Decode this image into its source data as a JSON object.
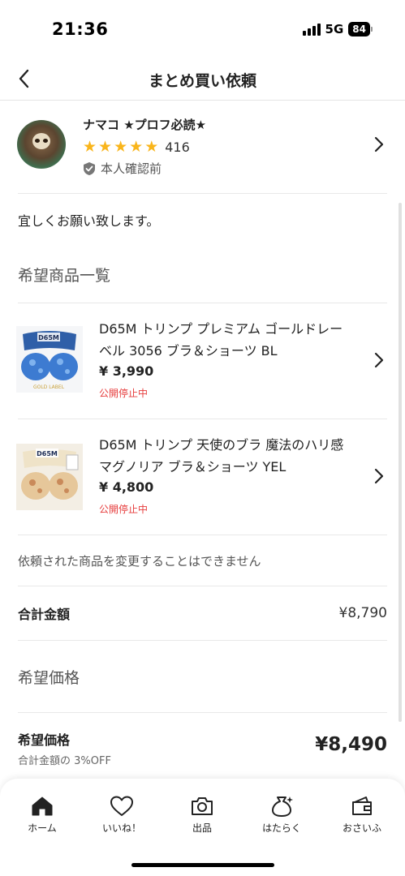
{
  "status_bar": {
    "time": "21:36",
    "network": "5G",
    "battery": "84"
  },
  "header": {
    "title": "まとめ買い依頼",
    "back_icon": "chevron-left-icon"
  },
  "seller": {
    "name": "ナマコ ★プロフ必読★",
    "rating_stars": 5,
    "rating_count": "416",
    "verification": "本人確認前"
  },
  "message": "宜しくお願い致します。",
  "items_section_title": "希望商品一覧",
  "items": [
    {
      "name": "D65M トリンプ プレミアム ゴールドレーベル 3056 ブラ＆ショーツ BL",
      "price": "¥ 3,990",
      "status": "公開停止中",
      "thumb_label": "D65M",
      "thumb_caption": "GOLD LABEL"
    },
    {
      "name": "D65M トリンプ 天使のブラ 魔法のハリ感 マグノリア ブラ＆ショーツ YEL",
      "price": "¥ 4,800",
      "status": "公開停止中",
      "thumb_label": "D65M"
    }
  ],
  "note": "依頼された商品を変更することはできません",
  "total": {
    "label": "合計金額",
    "value": "¥8,790"
  },
  "desired_section_title": "希望価格",
  "desired": {
    "label": "希望価格",
    "sub": "合計金額の 3%OFF",
    "value": "¥8,490"
  },
  "tabs": [
    {
      "label": "ホーム",
      "icon": "home-icon"
    },
    {
      "label": "いいね！",
      "icon": "heart-icon"
    },
    {
      "label": "出品",
      "icon": "camera-icon"
    },
    {
      "label": "はたらく",
      "icon": "money-bag-icon"
    },
    {
      "label": "おさいふ",
      "icon": "wallet-icon"
    }
  ],
  "colors": {
    "star": "#f9b51b",
    "status_red": "#e63b3b"
  }
}
